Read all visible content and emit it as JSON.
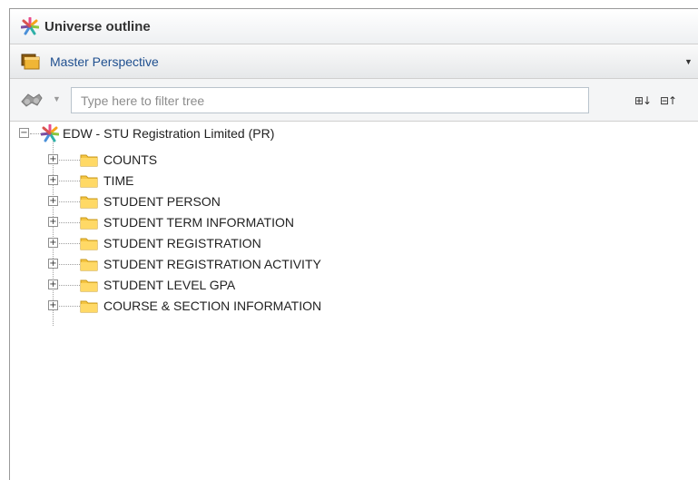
{
  "header": {
    "title": "Universe outline"
  },
  "perspective": {
    "label": "Master Perspective"
  },
  "filter": {
    "placeholder": "Type here to filter tree"
  },
  "tree": {
    "root": {
      "label": "EDW - STU Registration Limited (PR)",
      "toggle": "−"
    },
    "folders": [
      {
        "label": "COUNTS",
        "toggle": "+"
      },
      {
        "label": "TIME",
        "toggle": "+"
      },
      {
        "label": "STUDENT PERSON",
        "toggle": "+"
      },
      {
        "label": "STUDENT TERM INFORMATION",
        "toggle": "+"
      },
      {
        "label": "STUDENT REGISTRATION",
        "toggle": "+"
      },
      {
        "label": "STUDENT REGISTRATION ACTIVITY",
        "toggle": "+"
      },
      {
        "label": "STUDENT LEVEL GPA",
        "toggle": "+"
      },
      {
        "label": "COURSE & SECTION INFORMATION",
        "toggle": "+"
      }
    ]
  },
  "toolbar": {
    "expand_all": "⊞↓",
    "collapse_all": "⊟↑"
  },
  "colors": {
    "perspective_text": "#1f4f8f",
    "folder": "#f5c542"
  }
}
